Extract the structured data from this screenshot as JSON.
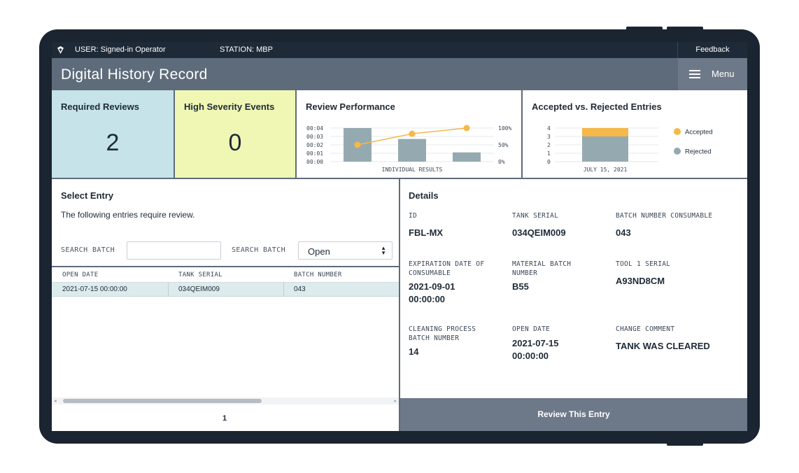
{
  "topbar": {
    "user": "USER: Signed-in Operator",
    "station": "STATION: MBP",
    "feedback": "Feedback"
  },
  "header": {
    "title": "Digital History Record",
    "menu_label": "Menu"
  },
  "cards": {
    "required_reviews": {
      "title": "Required Reviews",
      "value": "2",
      "color": "#c5e3e8"
    },
    "high_severity": {
      "title": "High Severity Events",
      "value": "0",
      "color": "#f0f7b4"
    }
  },
  "review_performance": {
    "title": "Review Performance",
    "xlabel": "INDIVIDUAL RESULTS",
    "y_left_ticks": [
      "00:04",
      "00:03",
      "00:02",
      "00:01",
      "00:00"
    ],
    "y_right_ticks": [
      "100%",
      "50%",
      "0%"
    ]
  },
  "accepted_rejected": {
    "title": "Accepted vs. Rejected Entries",
    "y_ticks": [
      "4",
      "3",
      "2",
      "1",
      "0"
    ],
    "x_tick": "JULY 15, 2021",
    "legend": [
      "Accepted",
      "Rejected"
    ]
  },
  "chart_data": [
    {
      "type": "bar",
      "title": "Review Performance",
      "xlabel": "INDIVIDUAL RESULTS",
      "ylim": [
        0,
        4
      ],
      "y2lim": [
        0,
        100
      ],
      "series": [
        {
          "kind": "bar",
          "values": [
            4,
            2.7,
            1.1
          ],
          "color": "#95a9b0"
        },
        {
          "kind": "line",
          "axis": "right",
          "values": [
            50,
            83,
            100
          ],
          "color": "#f5b849"
        }
      ]
    },
    {
      "type": "bar",
      "title": "Accepted vs. Rejected Entries",
      "categories": [
        "JULY 15, 2021"
      ],
      "ylim": [
        0,
        4
      ],
      "stacked": true,
      "series": [
        {
          "name": "Rejected",
          "values": [
            3
          ],
          "color": "#95a9b0"
        },
        {
          "name": "Accepted",
          "values": [
            1
          ],
          "color": "#f5b849"
        }
      ]
    }
  ],
  "select_entry": {
    "title": "Select Entry",
    "subtitle": "The following entries require review.",
    "search_label_1": "SEARCH BATCH",
    "search_value_1": "",
    "search_label_2": "SEARCH BATCH",
    "status_value": "Open",
    "columns": [
      "OPEN DATE",
      "TANK SERIAL",
      "BATCH NUMBER"
    ],
    "rows": [
      [
        "2021-07-15 00:00:00",
        "034QEIM009",
        "043"
      ]
    ],
    "page": "1"
  },
  "details": {
    "title": "Details",
    "fields": [
      {
        "label": "ID",
        "value": "FBL-MX"
      },
      {
        "label": "TANK SERIAL",
        "value": "034QEIM009"
      },
      {
        "label": "BATCH NUMBER CONSUMABLE",
        "value": "043"
      },
      {
        "label": "EXPIRATION DATE OF CONSUMABLE",
        "value": "2021-09-01 00:00:00"
      },
      {
        "label": "MATERIAL BATCH NUMBER",
        "value": "B55"
      },
      {
        "label": "TOOL 1 SERIAL",
        "value": "A93ND8CM"
      },
      {
        "label": "CLEANING PROCESS BATCH NUMBER",
        "value": "14"
      },
      {
        "label": "OPEN DATE",
        "value": "2021-07-15 00:00:00"
      },
      {
        "label": "CHANGE COMMENT",
        "value": "TANK WAS CLEARED"
      }
    ],
    "action_label": "Review This Entry"
  }
}
